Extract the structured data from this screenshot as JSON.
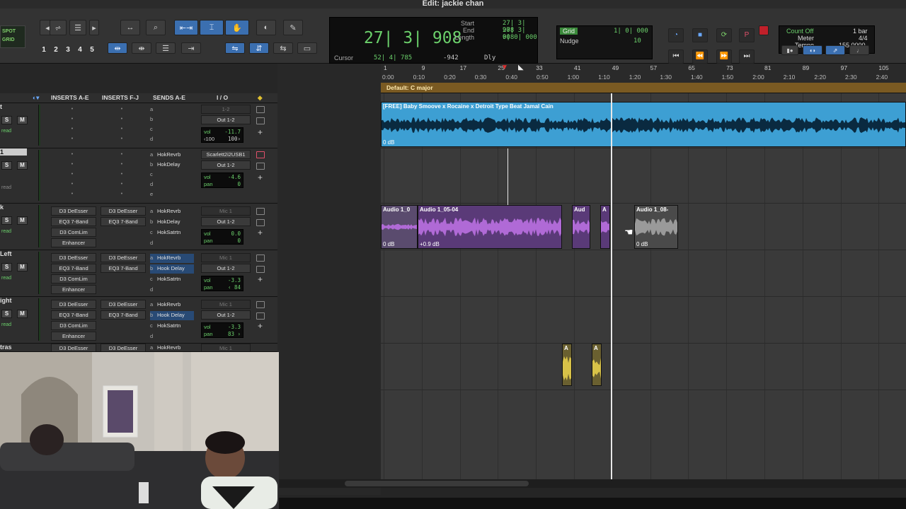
{
  "window": {
    "title": "Edit: jackie chan"
  },
  "toolbar": {
    "spot": "SPOT",
    "grid": "GRID",
    "zoom_presets": [
      "1",
      "2",
      "3",
      "4",
      "5"
    ]
  },
  "counter": {
    "main": "27| 3| 908",
    "start_label": "Start",
    "start": "27| 3| 908",
    "end_label": "End",
    "end": "27| 3| 908",
    "length_label": "Length",
    "length": "0| 0| 000",
    "cursor_label": "Cursor",
    "cursor": "52| 4| 785",
    "cursor_value": "-942",
    "dly": "Dly"
  },
  "grid_nudge": {
    "grid_label": "Grid",
    "grid_value": "1| 0| 000",
    "nudge_label": "Nudge",
    "nudge_value": "10"
  },
  "meter": {
    "count_off": "Count Off",
    "count_value": "1 bar",
    "meter_label": "Meter",
    "meter_value": "4/4",
    "tempo_label": "Tempo",
    "tempo_value": "155.0000"
  },
  "mix_header": {
    "inserts_ae": "INSERTS A-E",
    "inserts_fj": "INSERTS F-J",
    "sends_ae": "SENDS A-E",
    "io": "I / O"
  },
  "tracks": [
    {
      "name": "t",
      "read": "read",
      "inserts_ae": [],
      "inserts_fj": [],
      "sends": [
        {
          "slot": "a",
          "name": ""
        },
        {
          "slot": "b",
          "name": ""
        },
        {
          "slot": "c",
          "name": ""
        },
        {
          "slot": "d",
          "name": ""
        }
      ],
      "in": "1-2",
      "out": "Out 1-2",
      "vol": "-11.7",
      "pan_l": "‹100",
      "pan_r": "100›"
    },
    {
      "name": "1",
      "read": "read",
      "inserts_ae": [],
      "inserts_fj": [],
      "sends": [
        {
          "slot": "a",
          "name": "HokRevrb"
        },
        {
          "slot": "b",
          "name": "HokDelay"
        },
        {
          "slot": "c",
          "name": ""
        },
        {
          "slot": "d",
          "name": ""
        },
        {
          "slot": "e",
          "name": ""
        }
      ],
      "in": "Scarlett2i2USB1",
      "out": "Out 1-2",
      "vol": "-4.6",
      "pan": "0"
    },
    {
      "name": "k",
      "read": "read",
      "inserts_ae": [
        "D3 DeEsser",
        "EQ3 7-Band",
        "D3 ComLim",
        "Enhancer"
      ],
      "inserts_fj": [
        "D3 DeEsser",
        "EQ3 7-Band"
      ],
      "sends": [
        {
          "slot": "a",
          "name": "HokRevrb"
        },
        {
          "slot": "b",
          "name": "HokDelay"
        },
        {
          "slot": "c",
          "name": "HokSatrtn"
        },
        {
          "slot": "d",
          "name": ""
        }
      ],
      "in": "Mic 1",
      "out": "Out 1-2",
      "vol": "0.0",
      "pan": "0"
    },
    {
      "name": "Left",
      "read": "read",
      "inserts_ae": [
        "D3 DeEsser",
        "EQ3 7-Band",
        "D3 ComLim",
        "Enhancer"
      ],
      "inserts_fj": [
        "D3 DeEsser",
        "EQ3 7-Band"
      ],
      "sends": [
        {
          "slot": "a",
          "name": "HokRevrb"
        },
        {
          "slot": "b",
          "name": "Hook Delay"
        },
        {
          "slot": "c",
          "name": "HokSatrtn"
        },
        {
          "slot": "d",
          "name": ""
        }
      ],
      "in": "Mic 1",
      "out": "Out 1-2",
      "vol": "-3.3",
      "pan": "‹ 84"
    },
    {
      "name": "ight",
      "read": "read",
      "inserts_ae": [
        "D3 DeEsser",
        "EQ3 7-Band",
        "D3 ComLim",
        "Enhancer"
      ],
      "inserts_fj": [
        "D3 DeEsser",
        "EQ3 7-Band"
      ],
      "sends": [
        {
          "slot": "a",
          "name": "HokRevrb"
        },
        {
          "slot": "b",
          "name": "Hook Delay"
        },
        {
          "slot": "c",
          "name": "HokSatrtn"
        },
        {
          "slot": "d",
          "name": ""
        }
      ],
      "in": "Mic 1",
      "out": "Out 1-2",
      "vol": "-3.3",
      "pan": "83 ›"
    },
    {
      "name": "tras",
      "inserts_ae": [
        "D3 DeEsser"
      ],
      "inserts_fj": [
        "D3 DeEsser"
      ],
      "sends": [
        {
          "slot": "a",
          "name": "HokRevrb"
        }
      ],
      "in": "Mic 1"
    }
  ],
  "ruler": {
    "bars": [
      "1",
      "9",
      "17",
      "25",
      "33",
      "41",
      "49",
      "57",
      "65",
      "73",
      "81",
      "89",
      "97",
      "105"
    ],
    "minsecs": [
      "0:00",
      "0:10",
      "0:20",
      "0:30",
      "0:40",
      "0:50",
      "1:00",
      "1:10",
      "1:20",
      "1:30",
      "1:40",
      "1:50",
      "2:00",
      "2:10",
      "2:20",
      "2:30",
      "2:40"
    ],
    "key_signature": "Default: C major"
  },
  "clips": {
    "beat": {
      "name": "[FREE] Baby Smoove x Rocaine x Detroit Type Beat Jamal Cain",
      "gain": "0 dB",
      "color": "#3d9fd3"
    },
    "vocal_a": {
      "name": "Audio 1_0",
      "gain": "0 dB"
    },
    "vocal_b": {
      "name": "Audio 1_05-04",
      "gain": "+0.9 dB"
    },
    "vocal_c": {
      "name": "Aud"
    },
    "vocal_d": {
      "name": "A"
    },
    "vocal_e": {
      "name": "Audio 1_08-",
      "gain": "0 dB"
    },
    "adlib_1": {
      "name": "A"
    },
    "adlib_2": {
      "name": "A"
    },
    "vocal_color": "#8b3fc8",
    "adlib_color": "#c9b23a"
  }
}
